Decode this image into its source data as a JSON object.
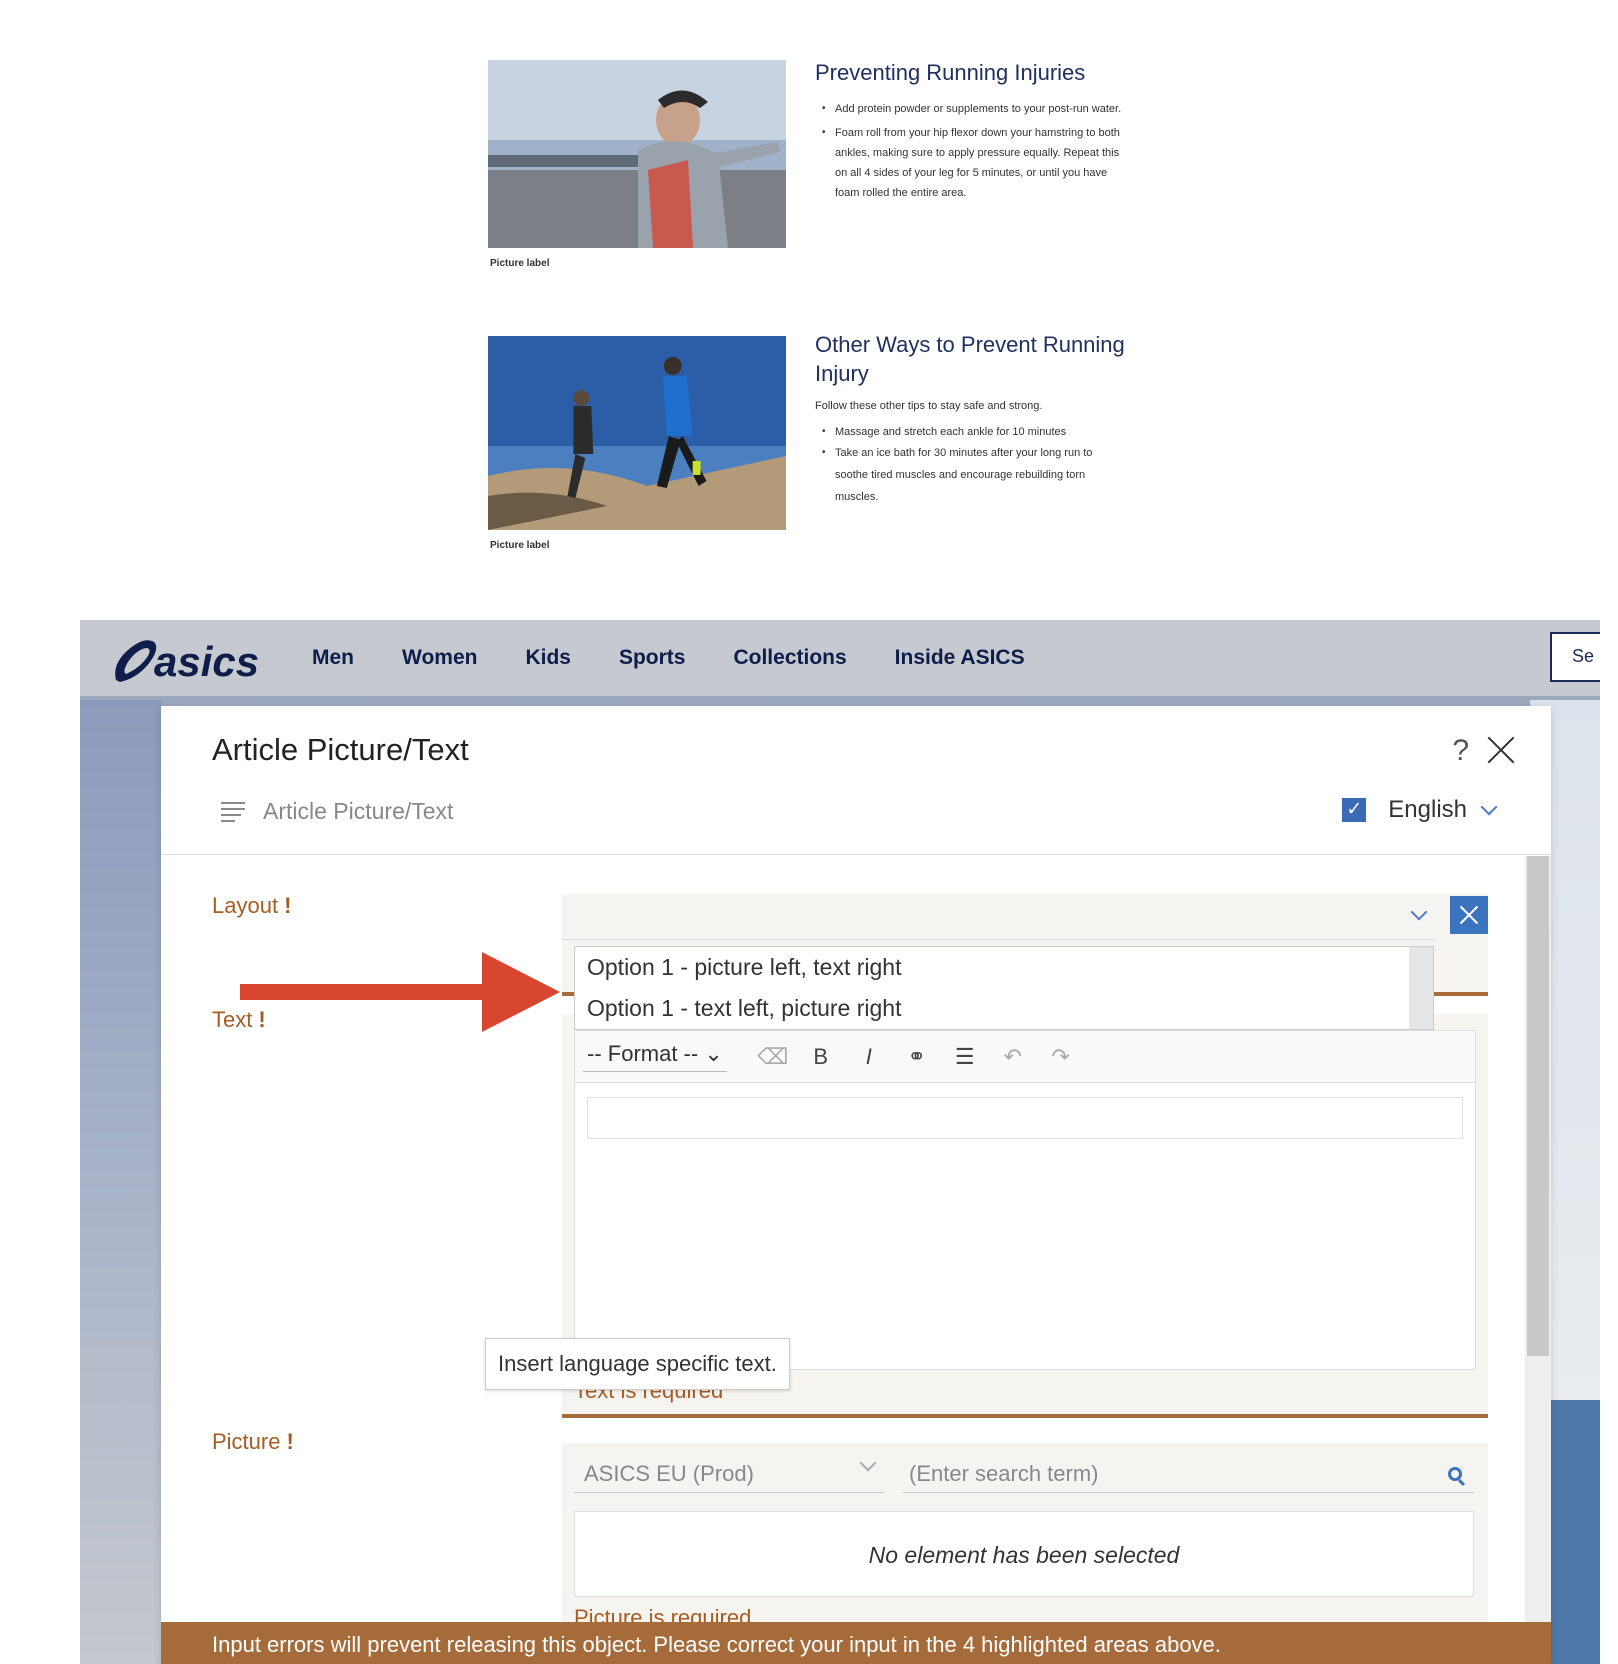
{
  "preview": {
    "block1": {
      "title": "Preventing Running Injuries",
      "bullets": [
        "Add protein powder or supplements to your post-run water.",
        "Foam roll from your hip flexor down your hamstring to both ankles, making sure to apply pressure equally. Repeat this on all 4 sides of your leg for 5 minutes, or until you have foam rolled the entire area."
      ],
      "picture_label": "Picture label"
    },
    "block2": {
      "title": "Other Ways to Prevent Running Injury",
      "intro": "Follow these other tips to stay safe and strong.",
      "bullets": [
        "Massage and stretch each ankle for 10 minutes",
        "Take an ice bath for 30 minutes after your long run to soothe tired muscles and encourage rebuilding torn muscles."
      ],
      "picture_label": "Picture label"
    }
  },
  "site": {
    "logo": "asics",
    "nav": [
      "Men",
      "Women",
      "Kids",
      "Sports",
      "Collections",
      "Inside ASICS"
    ],
    "search_partial": "Se"
  },
  "dialog": {
    "title": "Article Picture/Text",
    "help": "?",
    "subtitle": "Article Picture/Text",
    "language": "English",
    "fields": {
      "layout": {
        "label": "Layout",
        "required_mark": "!",
        "options": [
          "Option 1 - picture left, text right",
          "Option 1 - text left, picture right"
        ]
      },
      "text": {
        "label": "Text",
        "required_mark": "!",
        "format_label": "-- Format --",
        "bold": "B",
        "italic": "I",
        "error": "Text is required",
        "tooltip": "Insert language specific text."
      },
      "picture": {
        "label": "Picture",
        "required_mark": "!",
        "source": "ASICS EU (Prod)",
        "search_placeholder": "(Enter search term)",
        "empty": "No element has been selected",
        "error": "Picture is required"
      }
    },
    "error_bar": "Input errors will prevent releasing this object. Please correct your input in the 4 highlighted areas above."
  },
  "colors": {
    "accent_blue": "#3b73be",
    "error_brown": "#a56b3b",
    "nav_navy": "#0f1d4a",
    "arrow_red": "#d9462f"
  }
}
